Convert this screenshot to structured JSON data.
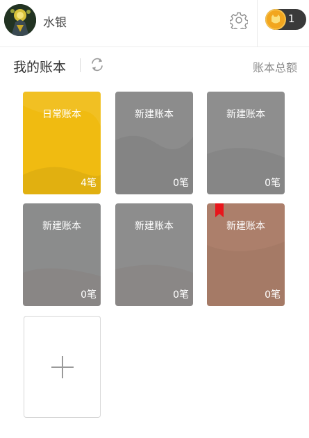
{
  "header": {
    "username": "水银",
    "coin_count": "1"
  },
  "section": {
    "title": "我的账本",
    "total_link": "账本总额"
  },
  "books": [
    {
      "name": "日常账本",
      "count": "4笔",
      "color": "#f0bb11",
      "bookmark": false
    },
    {
      "name": "新建账本",
      "count": "0笔",
      "color": "#8c8c8c",
      "bookmark": false
    },
    {
      "name": "新建账本",
      "count": "0笔",
      "color": "#8e8e8e",
      "bookmark": false
    },
    {
      "name": "新建账本",
      "count": "0笔",
      "color": "#8b8c8c",
      "bookmark": false
    },
    {
      "name": "新建账本",
      "count": "0笔",
      "color": "#8d8d8d",
      "bookmark": false
    },
    {
      "name": "新建账本",
      "count": "0笔",
      "color": "#ac7f6b",
      "bookmark": true
    }
  ],
  "colors": {
    "bookmark": "#e8161b",
    "coin": "#f2a61e"
  }
}
